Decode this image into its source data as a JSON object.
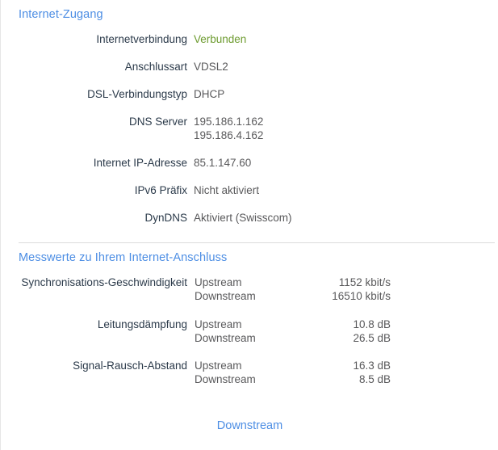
{
  "sections": {
    "internet_access": {
      "title": "Internet-Zugang",
      "rows": [
        {
          "label": "Internetverbindung",
          "value": "Verbunden",
          "status": "ok"
        },
        {
          "label": "Anschlussart",
          "value": "VDSL2"
        },
        {
          "label": "DSL-Verbindungstyp",
          "value": "DHCP"
        },
        {
          "label": "DNS Server",
          "value": "195.186.1.162",
          "value2": "195.186.4.162"
        },
        {
          "label": "Internet IP-Adresse",
          "value": "85.1.147.60"
        },
        {
          "label": "IPv6 Präfix",
          "value": "Nicht aktiviert"
        },
        {
          "label": "DynDNS",
          "value": "Aktiviert (Swisscom)"
        }
      ]
    },
    "measurements": {
      "title": "Messwerte zu Ihrem Internet-Anschluss",
      "rows": [
        {
          "label": "Synchronisations-Geschwindigkeit",
          "upstream_label": "Upstream",
          "upstream_value": "1152 kbit/s",
          "downstream_label": "Downstream",
          "downstream_value": "16510 kbit/s"
        },
        {
          "label": "Leitungsdämpfung",
          "upstream_label": "Upstream",
          "upstream_value": "10.8 dB",
          "downstream_label": "Downstream",
          "downstream_value": "26.5 dB"
        },
        {
          "label": "Signal-Rausch-Abstand",
          "upstream_label": "Upstream",
          "upstream_value": "16.3 dB",
          "downstream_label": "Downstream",
          "downstream_value": "8.5 dB"
        }
      ]
    }
  },
  "footer": {
    "link_label": "Downstream"
  },
  "colors": {
    "heading_blue": "#4d8ee4",
    "label_dark": "#2b3a4a",
    "value_gray": "#59595b",
    "status_green": "#6d9b2f",
    "divider": "#dcdcdc",
    "background": "#ffffff"
  }
}
